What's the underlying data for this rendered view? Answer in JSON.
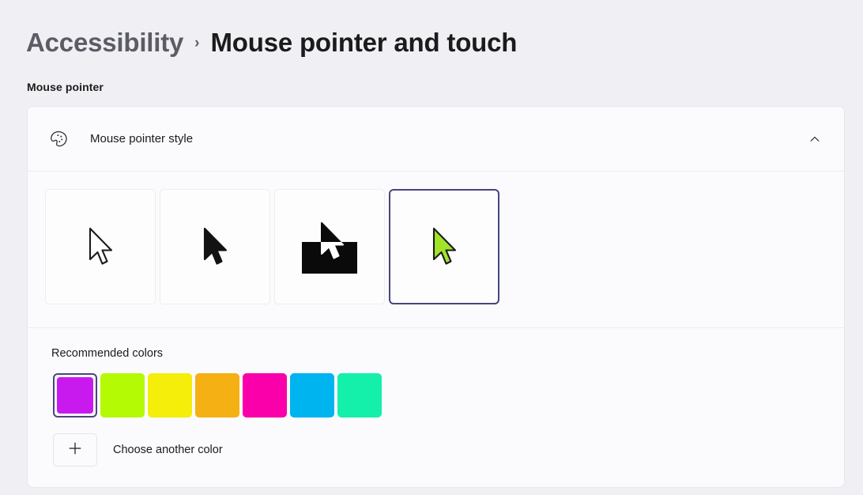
{
  "breadcrumb": {
    "parent": "Accessibility",
    "separator": "›",
    "current": "Mouse pointer and touch"
  },
  "section": {
    "label": "Mouse pointer"
  },
  "card": {
    "header": {
      "icon": "palette-icon",
      "title": "Mouse pointer style",
      "expander_icon": "chevron-up-icon",
      "expanded": true
    },
    "pointer_styles": [
      {
        "name": "white",
        "selected": false
      },
      {
        "name": "black",
        "selected": false
      },
      {
        "name": "inverted",
        "selected": false
      },
      {
        "name": "custom",
        "selected": true,
        "color": "#a2e32a"
      }
    ],
    "colors": {
      "title": "Recommended colors",
      "swatches": [
        {
          "name": "purple",
          "color": "#c81aee",
          "selected": true
        },
        {
          "name": "lime",
          "color": "#b4fa05",
          "selected": false
        },
        {
          "name": "yellow",
          "color": "#f5ee0a",
          "selected": false
        },
        {
          "name": "amber",
          "color": "#f5b014",
          "selected": false
        },
        {
          "name": "magenta",
          "color": "#fa00aa",
          "selected": false
        },
        {
          "name": "blue",
          "color": "#00b4f0",
          "selected": false
        },
        {
          "name": "teal",
          "color": "#14f0aa",
          "selected": false
        }
      ],
      "choose_another": {
        "icon": "plus-icon",
        "label": "Choose another color"
      }
    }
  },
  "theme": {
    "page_background": "#f0f0f4",
    "card_background": "#fbfbfd",
    "accent_selection": "#47457f",
    "text_primary": "#1b1b1b",
    "text_secondary": "#5c5c66"
  }
}
